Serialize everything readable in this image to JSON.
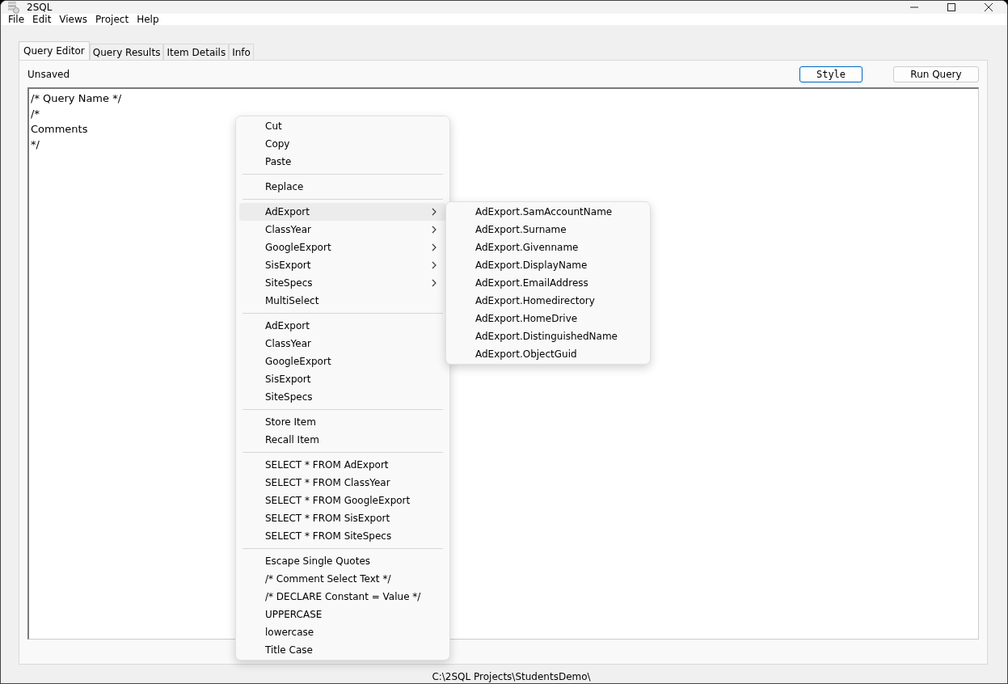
{
  "window": {
    "title": "2SQL"
  },
  "menu_bar": [
    "File",
    "Edit",
    "Views",
    "Project",
    "Help"
  ],
  "tabs": [
    {
      "label": "Query Editor",
      "selected": true
    },
    {
      "label": "Query Results",
      "selected": false
    },
    {
      "label": "Item Details",
      "selected": false
    },
    {
      "label": "Info",
      "selected": false
    }
  ],
  "editor": {
    "status": "Unsaved",
    "buttons": [
      {
        "label": "Style",
        "kind": "style"
      },
      {
        "label": "Run Query",
        "kind": "run"
      }
    ],
    "lines": [
      "/* Query Name */",
      "/*",
      "Comments",
      "*/"
    ]
  },
  "context_menu": {
    "groups": [
      [
        {
          "label": "Cut",
          "kind": "command",
          "selected": false
        },
        {
          "label": "Copy",
          "kind": "command",
          "selected": false
        },
        {
          "label": "Paste",
          "kind": "command",
          "selected": false
        }
      ],
      [
        {
          "label": "Replace",
          "kind": "command",
          "selected": false
        }
      ],
      [
        {
          "label": "AdExport",
          "kind": "submenu",
          "selected": true,
          "submenu": [
            "AdExport.SamAccountName",
            "AdExport.Surname",
            "AdExport.Givenname",
            "AdExport.DisplayName",
            "AdExport.EmailAddress",
            "AdExport.Homedirectory",
            "AdExport.HomeDrive",
            "AdExport.DistinguishedName",
            "AdExport.ObjectGuid"
          ]
        },
        {
          "label": "ClassYear",
          "kind": "submenu",
          "selected": false
        },
        {
          "label": "GoogleExport",
          "kind": "submenu",
          "selected": false
        },
        {
          "label": "SisExport",
          "kind": "submenu",
          "selected": false
        },
        {
          "label": "SiteSpecs",
          "kind": "submenu",
          "selected": false
        },
        {
          "label": "MultiSelect",
          "kind": "command",
          "selected": false
        }
      ],
      [
        {
          "label": "AdExport",
          "kind": "command",
          "selected": false
        },
        {
          "label": "ClassYear",
          "kind": "command",
          "selected": false
        },
        {
          "label": "GoogleExport",
          "kind": "command",
          "selected": false
        },
        {
          "label": "SisExport",
          "kind": "command",
          "selected": false
        },
        {
          "label": "SiteSpecs",
          "kind": "command",
          "selected": false
        }
      ],
      [
        {
          "label": "Store Item",
          "kind": "command",
          "selected": false
        },
        {
          "label": "Recall Item",
          "kind": "command",
          "selected": false
        }
      ],
      [
        {
          "label": "SELECT * FROM AdExport",
          "kind": "command",
          "selected": false
        },
        {
          "label": "SELECT * FROM ClassYear",
          "kind": "command",
          "selected": false
        },
        {
          "label": "SELECT * FROM GoogleExport",
          "kind": "command",
          "selected": false
        },
        {
          "label": "SELECT * FROM SisExport",
          "kind": "command",
          "selected": false
        },
        {
          "label": "SELECT * FROM SiteSpecs",
          "kind": "command",
          "selected": false
        }
      ],
      [
        {
          "label": "Escape Single Quotes",
          "kind": "command",
          "selected": false
        },
        {
          "label": "/* Comment Select Text */",
          "kind": "command",
          "selected": false
        },
        {
          "label": "/* DECLARE Constant = Value */",
          "kind": "command",
          "selected": false
        },
        {
          "label": "UPPERCASE",
          "kind": "command",
          "selected": false
        },
        {
          "label": "lowercase",
          "kind": "command",
          "selected": false
        },
        {
          "label": "Title Case",
          "kind": "command",
          "selected": false
        }
      ]
    ]
  },
  "status_bar": "C:\\2SQL Projects\\StudentsDemo\\"
}
